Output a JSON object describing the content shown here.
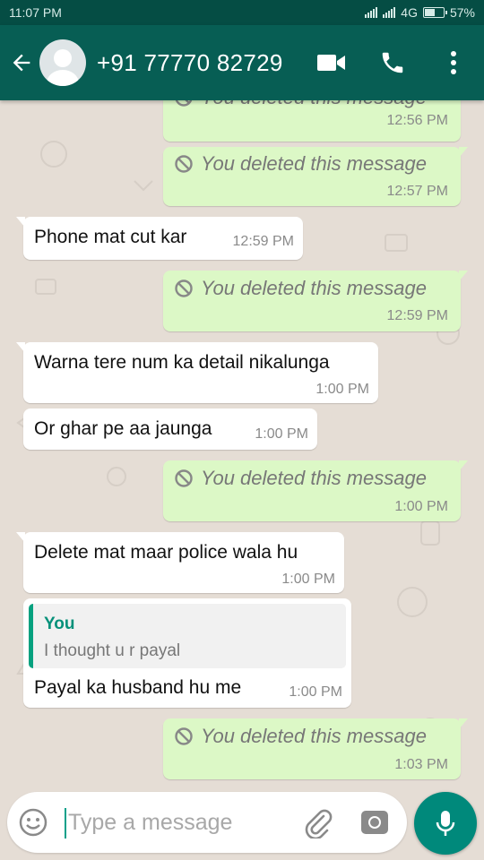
{
  "status_bar": {
    "time": "11:07 PM",
    "network": "4G",
    "battery": "57%",
    "battery_level": 0.57
  },
  "header": {
    "contact": "+91 77770 82729"
  },
  "icons": {
    "back": "arrow-left-icon",
    "avatar": "default-avatar-icon",
    "video": "video-call-icon",
    "call": "phone-icon",
    "menu": "more-vert-icon",
    "deleted": "blocked-circle-icon",
    "emoji": "emoji-icon",
    "attach": "paperclip-icon",
    "camera": "camera-icon",
    "mic": "microphone-icon"
  },
  "colors": {
    "header": "#075e54",
    "outgoing": "#dcf8c6",
    "incoming": "#ffffff",
    "accent": "#00897b"
  },
  "messages": [
    {
      "type": "out",
      "deleted": true,
      "text": "You deleted this message",
      "time": "12:56 PM"
    },
    {
      "type": "out",
      "deleted": true,
      "text": "You deleted this message",
      "time": "12:57 PM"
    },
    {
      "type": "in",
      "text": "Phone mat cut kar",
      "time": "12:59 PM"
    },
    {
      "type": "out",
      "deleted": true,
      "text": "You deleted this message",
      "time": "12:59 PM"
    },
    {
      "type": "in",
      "text": "Warna tere num ka detail nikalunga",
      "time": "1:00 PM"
    },
    {
      "type": "in",
      "text": "Or ghar pe aa jaunga",
      "time": "1:00 PM"
    },
    {
      "type": "out",
      "deleted": true,
      "text": "You deleted this message",
      "time": "1:00 PM"
    },
    {
      "type": "in",
      "text": "Delete mat maar police wala hu",
      "time": "1:00 PM"
    },
    {
      "type": "in",
      "text": "Payal ka husband hu me",
      "time": "1:00 PM",
      "quote": {
        "author": "You",
        "text": "I thought u r payal"
      }
    },
    {
      "type": "out",
      "deleted": true,
      "text": "You deleted this message",
      "time": "1:03 PM"
    }
  ],
  "input": {
    "placeholder": "Type a message"
  }
}
